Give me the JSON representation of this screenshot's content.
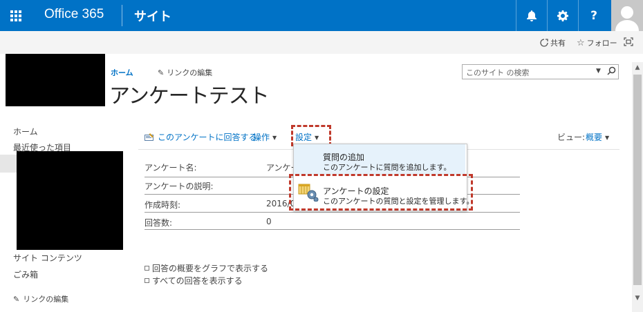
{
  "suite": {
    "app_title": "Office 365",
    "site_link": "サイト",
    "bell_glyph": "🔔",
    "help_label": "?"
  },
  "utility": {
    "share_label": "共有",
    "follow_label": "フォロー"
  },
  "breadcrumb": {
    "home": "ホーム",
    "edit_links": "リンクの編集"
  },
  "page": {
    "title": "アンケートテスト"
  },
  "search": {
    "placeholder": "このサイト の検索"
  },
  "quick_launch": {
    "items": [
      "ホーム",
      "最近使った項目",
      "サイト コンテンツ",
      "ごみ箱"
    ],
    "edit_links": "リンクの編集"
  },
  "toolbar": {
    "respond": "このアンケートに回答する",
    "actions": "操作",
    "settings": "設定",
    "view_label": "ビュー:",
    "view_value": "概要"
  },
  "details": {
    "rows": [
      {
        "label": "アンケート名:",
        "value": "アンケー"
      },
      {
        "label": "アンケートの説明:",
        "value": ""
      },
      {
        "label": "作成時刻:",
        "value": "2016/0"
      },
      {
        "label": "回答数:",
        "value": "0"
      }
    ]
  },
  "settings_menu": {
    "items": [
      {
        "title": "質問の追加",
        "description": "このアンケートに質問を追加します。"
      },
      {
        "title": "アンケートの設定",
        "description": "このアンケートの質問と設定を管理します。"
      }
    ]
  },
  "bottom_links": [
    "回答の概要をグラフで表示する",
    "すべての回答を表示する"
  ],
  "colors": {
    "suite_bar": "#0072c6",
    "link": "#0072c6",
    "highlight": "#c0392b"
  }
}
